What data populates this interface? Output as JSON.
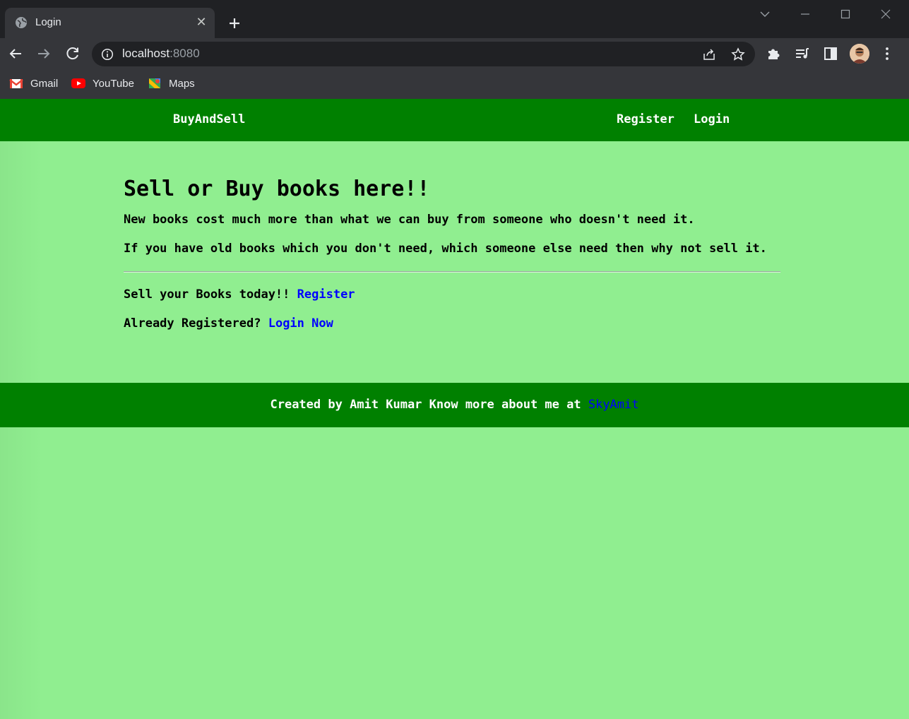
{
  "browser": {
    "tab": {
      "title": "Login",
      "close_glyph": "✕"
    },
    "address": {
      "host": "localhost",
      "port": ":8080"
    },
    "bookmarks": [
      {
        "label": "Gmail",
        "icon": "gmail-icon"
      },
      {
        "label": "YouTube",
        "icon": "youtube-icon"
      },
      {
        "label": "Maps",
        "icon": "maps-icon"
      }
    ]
  },
  "navbar": {
    "brand": "BuyAndSell",
    "register": "Register",
    "login": "Login"
  },
  "main": {
    "headline": "Sell or Buy books here!!",
    "para1": "New books cost much more than what we can buy from someone who doesn't need it.",
    "para2": "If you have old books which you don't need, which someone else need then why not sell it.",
    "sell_text": "Sell your Books today!!",
    "sell_link": "Register",
    "registered_text": "Already Registered?",
    "registered_link": "Login Now"
  },
  "footer": {
    "text": "Created by Amit Kumar Know more about me at",
    "link": "SkyAmit"
  },
  "colors": {
    "page_bg": "#90ee90",
    "bar_bg": "#008000",
    "link": "#0000ff"
  }
}
